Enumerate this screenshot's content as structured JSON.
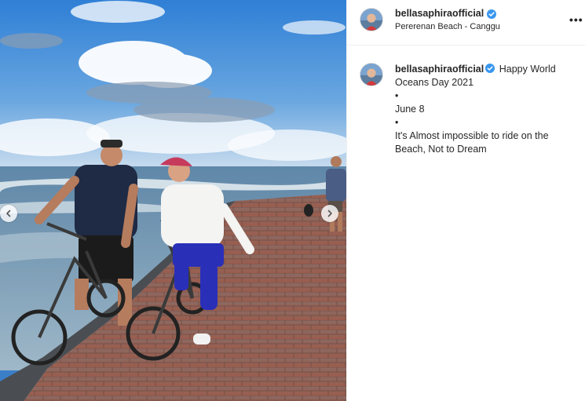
{
  "post": {
    "username": "bellasaphiraofficial",
    "location": "Pererenan Beach - Canggu",
    "more_label": "•••",
    "caption_lines": [
      "Happy World Oceans Day 2021",
      "•",
      "June 8",
      "•",
      "It's Almost impossible to ride on the Beach, Not to Dream"
    ]
  },
  "icons": {
    "verified": "verified-badge-icon",
    "prev": "chevron-left-icon",
    "next": "chevron-right-icon",
    "more": "more-options-icon"
  },
  "colors": {
    "verified_blue": "#3897f0",
    "text": "#262626",
    "divider": "#efefef"
  }
}
